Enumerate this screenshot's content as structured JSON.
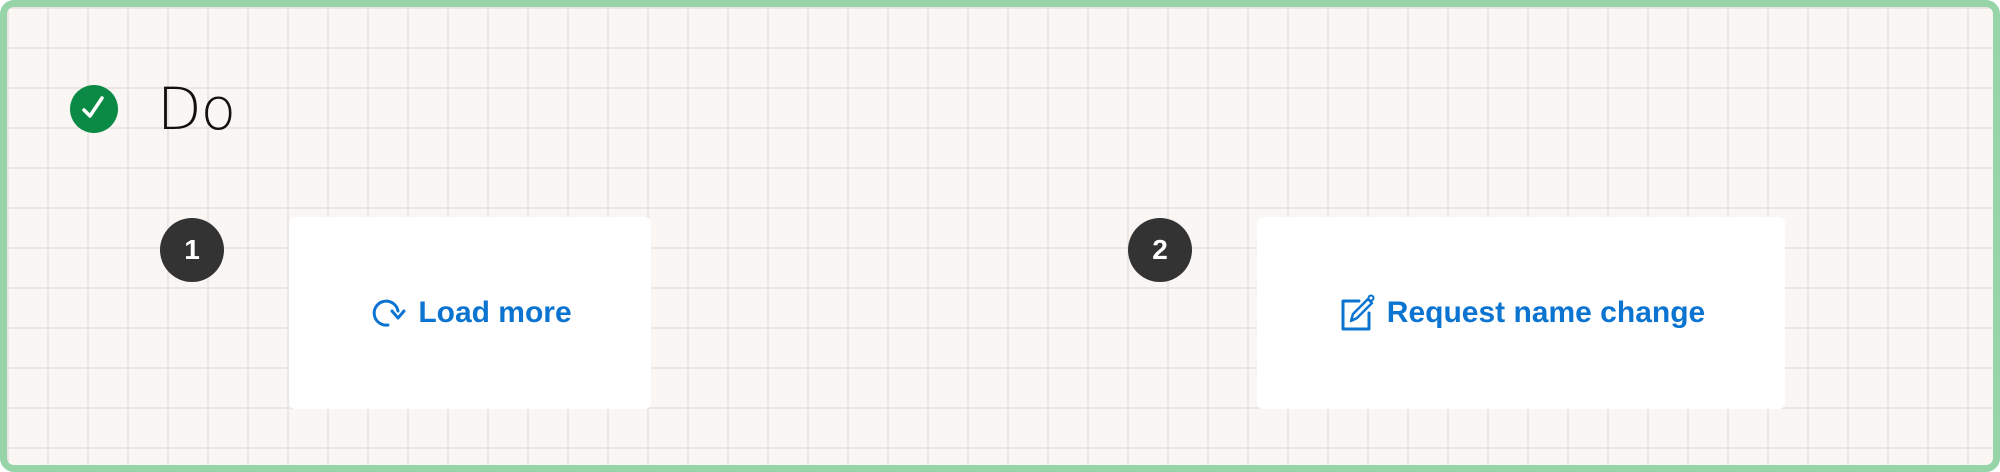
{
  "heading": {
    "text": "Do",
    "icon": "checkmark-circle-icon",
    "icon_color": "#0b8a46"
  },
  "examples": [
    {
      "step": "1",
      "button_label": "Load more",
      "button_icon": "refresh-icon"
    },
    {
      "step": "2",
      "button_label": "Request name change",
      "button_icon": "edit-icon"
    }
  ],
  "colors": {
    "frame_border": "#97d4a7",
    "background": "#faf6f3",
    "grid_line": "#ebe6e2",
    "link": "#0b74d0",
    "step_badge": "#333333"
  }
}
